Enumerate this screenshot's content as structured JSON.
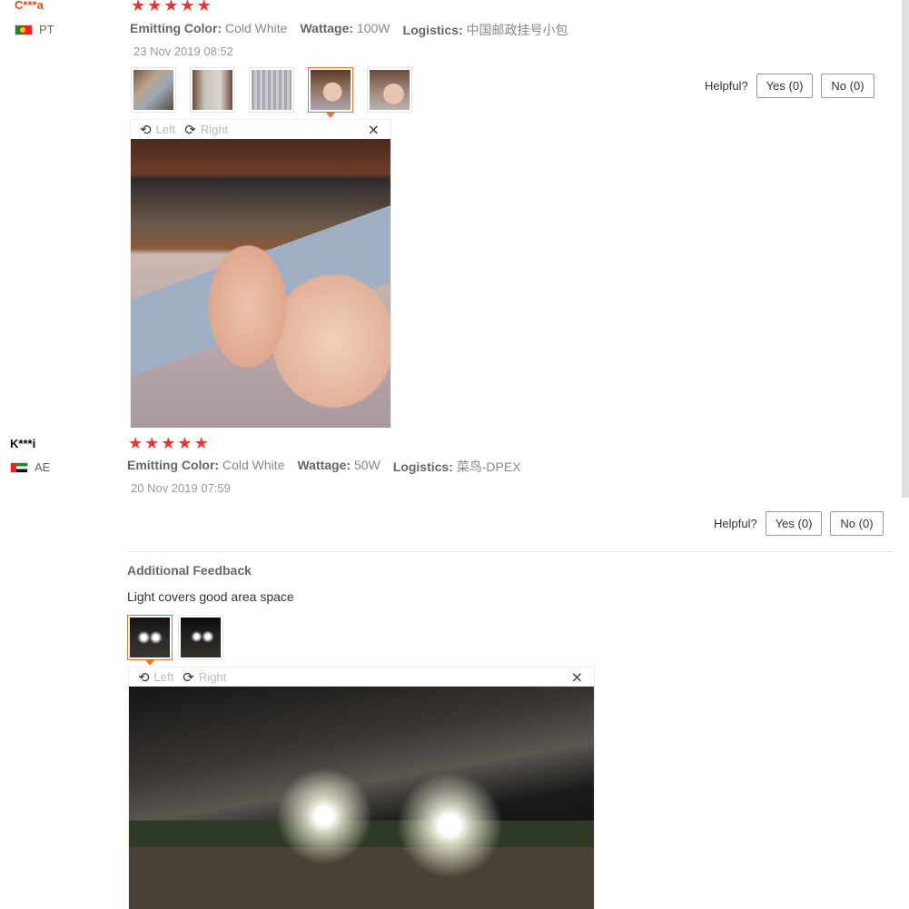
{
  "reviews": [
    {
      "user": "C***a",
      "country": "PT",
      "attributes": [
        {
          "key": "Emitting Color:",
          "value": "Cold White"
        },
        {
          "key": "Wattage:",
          "value": "100W"
        },
        {
          "key": "Logistics:",
          "value": "中国邮政挂号小包"
        }
      ],
      "date": "23 Nov 2019 08:52",
      "helpful_label": "Helpful?",
      "yes_label": "Yes (0)",
      "no_label": "No (0)",
      "viewer": {
        "left_label": "Left",
        "right_label": "Right",
        "close": "×"
      }
    },
    {
      "user": "K***i",
      "country": "AE",
      "attributes": [
        {
          "key": "Emitting Color:",
          "value": "Cold White"
        },
        {
          "key": "Wattage:",
          "value": "50W"
        },
        {
          "key": "Logistics:",
          "value": "菜鸟-DPEX"
        }
      ],
      "date": "20 Nov 2019 07:59",
      "helpful_label": "Helpful?",
      "yes_label": "Yes (0)",
      "no_label": "No (0)",
      "additional_title": "Additional Feedback",
      "additional_text": "Light covers good area space",
      "viewer": {
        "left_label": "Left",
        "right_label": "Right",
        "close": "×"
      }
    }
  ],
  "icons": {
    "star": "★",
    "rotate_left": "⟲",
    "rotate_right": "⟳"
  },
  "colors": {
    "star": "#ee3333",
    "active_thumb": "#f57224",
    "username_1": "#e64a19"
  }
}
